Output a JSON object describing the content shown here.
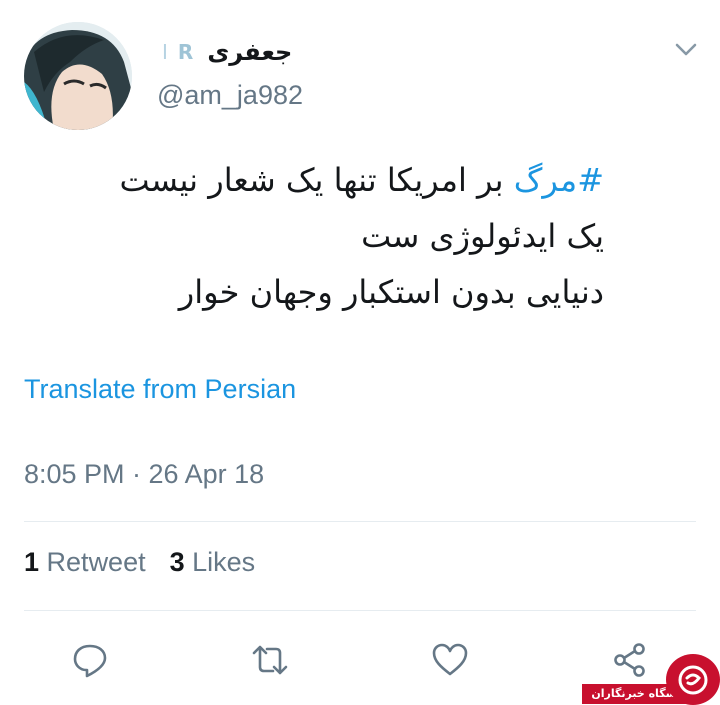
{
  "tweet": {
    "display_name": "جعفری",
    "badge_letters": [
      "I",
      "R"
    ],
    "handle": "@am_ja982",
    "text_lines": [
      {
        "hashtag": "#مرگ",
        "rest": " بر امریکا  تنها یک شعار نیست"
      },
      {
        "hashtag": "",
        "rest": "یک ایدئولوژی  ست"
      },
      {
        "hashtag": "",
        "rest": "دنیایی بدون استکبار وجهان خوار"
      }
    ],
    "translate_label": "Translate from Persian",
    "timestamp": "8:05 PM · 26 Apr 18"
  },
  "stats": {
    "retweets_count": "1",
    "retweets_label": "Retweet",
    "likes_count": "3",
    "likes_label": "Likes"
  },
  "actions": [
    {
      "name": "reply",
      "icon": "reply-icon"
    },
    {
      "name": "retweet",
      "icon": "retweet-icon"
    },
    {
      "name": "like",
      "icon": "heart-icon"
    },
    {
      "name": "share",
      "icon": "share-icon"
    }
  ],
  "watermark": {
    "text": "باشگاه خبرنگاران",
    "color": "#c8102e"
  },
  "colors": {
    "accent": "#1b95e0",
    "secondary_text": "#657786",
    "primary_text": "#14171a",
    "divider": "#e6ecf0"
  }
}
